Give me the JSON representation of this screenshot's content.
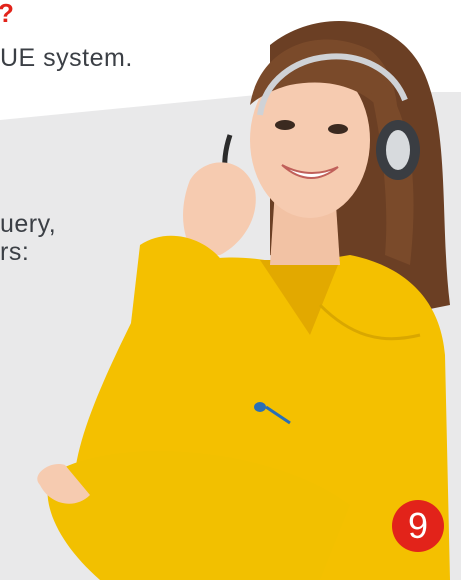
{
  "fragments": {
    "top_red": "?",
    "line1": "UE system.",
    "line2": "uery,",
    "line3": "rs:"
  },
  "page_badge": "9",
  "colors": {
    "accent_red": "#e2231a",
    "text_gray": "#3b3f45",
    "panel_gray": "#e9e9ea",
    "shirt_yellow": "#f4c000"
  },
  "illustration": "support-agent-with-headset"
}
